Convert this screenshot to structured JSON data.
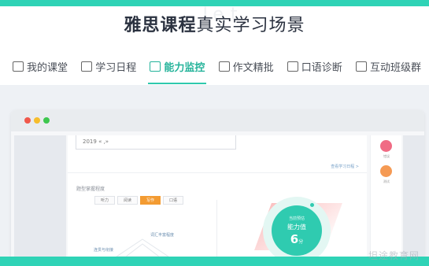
{
  "watermark_top": "Le           t",
  "headline": {
    "bold": "雅思课程",
    "rest": "真实学习场景"
  },
  "tabs": [
    {
      "label": "我的课堂",
      "icon": "monitor-icon",
      "active": false
    },
    {
      "label": "学习日程",
      "icon": "calendar-icon",
      "active": false
    },
    {
      "label": "能力监控",
      "icon": "chart-icon",
      "active": true
    },
    {
      "label": "作文精批",
      "icon": "document-icon",
      "active": false
    },
    {
      "label": "口语诊断",
      "icon": "schedule-icon",
      "active": false
    },
    {
      "label": "互动班级群",
      "icon": "chat-icon",
      "active": false
    }
  ],
  "window": {
    "year": "2019",
    "year_suffix": "« ,»",
    "more_link": "查看学习日程 >",
    "section_title": "题型掌握程度",
    "practice_tabs": [
      "听力",
      "阅读",
      "写作",
      "口语"
    ],
    "active_practice_tab": "写作",
    "radar_label_1": "词汇丰富程度",
    "radar_label_2": "连贯与衔接",
    "score_caption": "当前预估",
    "score_title": "能力值",
    "score_value": "6",
    "score_unit": "分",
    "side_items": [
      "错误",
      "测试"
    ]
  },
  "watermark_bottom": "坦途教育网",
  "colors": {
    "accent": "#2fd3b6",
    "active_tab": "#24b39a",
    "orange": "#f39b32"
  }
}
